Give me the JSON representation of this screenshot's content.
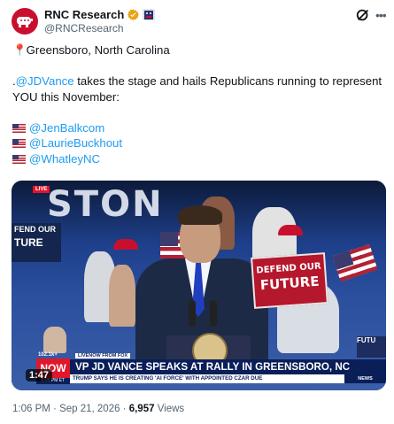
{
  "author": {
    "display_name": "RNC Research",
    "handle": "@RNCResearch",
    "verified_color": "#e8a317",
    "avatar_color": "#c8102e",
    "avatar_icon": "gop-elephant-icon"
  },
  "header_icons": [
    "grok-icon",
    "more-icon"
  ],
  "post": {
    "location_line": "Greensboro, North Carolina",
    "pin_icon": "📍",
    "line2_prefix": ".",
    "line2_mention": "@JDVance",
    "line2_rest": " takes the stage and hails Republicans running to represent",
    "line3": "YOU this November:",
    "candidates": [
      "@JenBalkcom",
      "@LaurieBuckhout",
      "@WhatleyNC"
    ]
  },
  "video": {
    "duration": "1:47",
    "headline": "VP JD VANCE SPEAKS AT RALLY IN GREENSBORO, NC",
    "ticker": "TRUMP SAYS HE IS CREATING 'AI FORCE' WITH APPOINTED CZAR DUE",
    "source_tag": "LIVENOW FROM FOX",
    "live_label": "LIVE",
    "now_logo": "NOW",
    "now_time": "6:05 PM ET",
    "temperature": "102.1k+",
    "news_tag": "NEWS",
    "stage_sign": "STON",
    "left_sign_line1": "FEND OUR",
    "left_sign_line2": "TURE",
    "defend_sign_line1": "DEFEND OUR",
    "defend_sign_line2": "FUTURE",
    "right_sign": "FUTU"
  },
  "meta": {
    "time": "1:06 PM",
    "separator": " · ",
    "date": "Sep 21, 2026",
    "views_count": "6,957",
    "views_label": " Views"
  }
}
